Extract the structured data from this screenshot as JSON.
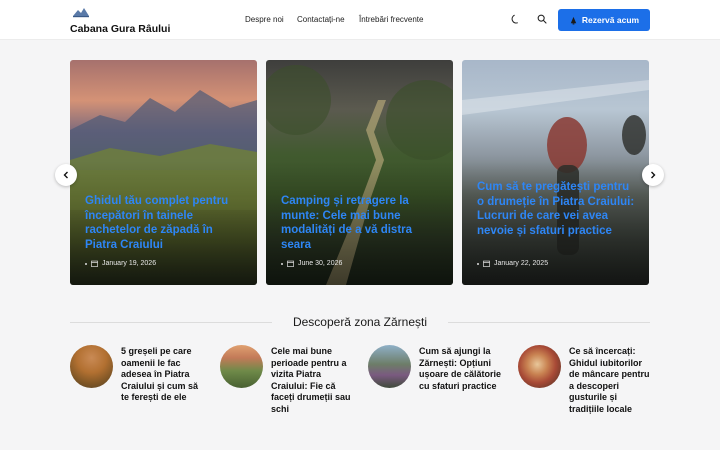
{
  "header": {
    "site_title": "Cabana Gura Râului",
    "nav": [
      "Despre noi",
      "Contactați-ne",
      "Întrebări frecvente"
    ],
    "cta_label": "Rezervă acum",
    "icons": {
      "theme": "moon-icon",
      "search": "search-icon",
      "cta": "bell-icon"
    },
    "accent_color": "#1c6fe8"
  },
  "carousel": {
    "cards": [
      {
        "title": "Ghidul tău complet pentru începători în tainele rachetelor de zăpadă în Piatra Craiului",
        "date": "January 19, 2026"
      },
      {
        "title": "Camping și retragere la munte: Cele mai bune modalități de a vă distra seara",
        "date": "June 30, 2026"
      },
      {
        "title": "Cum să te pregătești pentru o drumeție în Piatra Craiului: Lucruri de care vei avea nevoie și sfaturi practice",
        "date": "January 22, 2025"
      }
    ],
    "title_color": "#2e86f5"
  },
  "section": {
    "title": "Descoperă zona Zărnești",
    "items": [
      {
        "title": "5 greșeli pe care oamenii le fac adesea în Piatra Craiului și cum să te ferești de ele"
      },
      {
        "title": "Cele mai bune perioade pentru a vizita Piatra Craiului: Fie că faceți drumeții sau schi"
      },
      {
        "title": "Cum să ajungi la Zărnești: Opțiuni ușoare de călătorie cu sfaturi practice"
      },
      {
        "title": "Ce să încercați: Ghidul iubitorilor de mâncare pentru a descoperi gusturile și tradițiile locale"
      }
    ]
  }
}
